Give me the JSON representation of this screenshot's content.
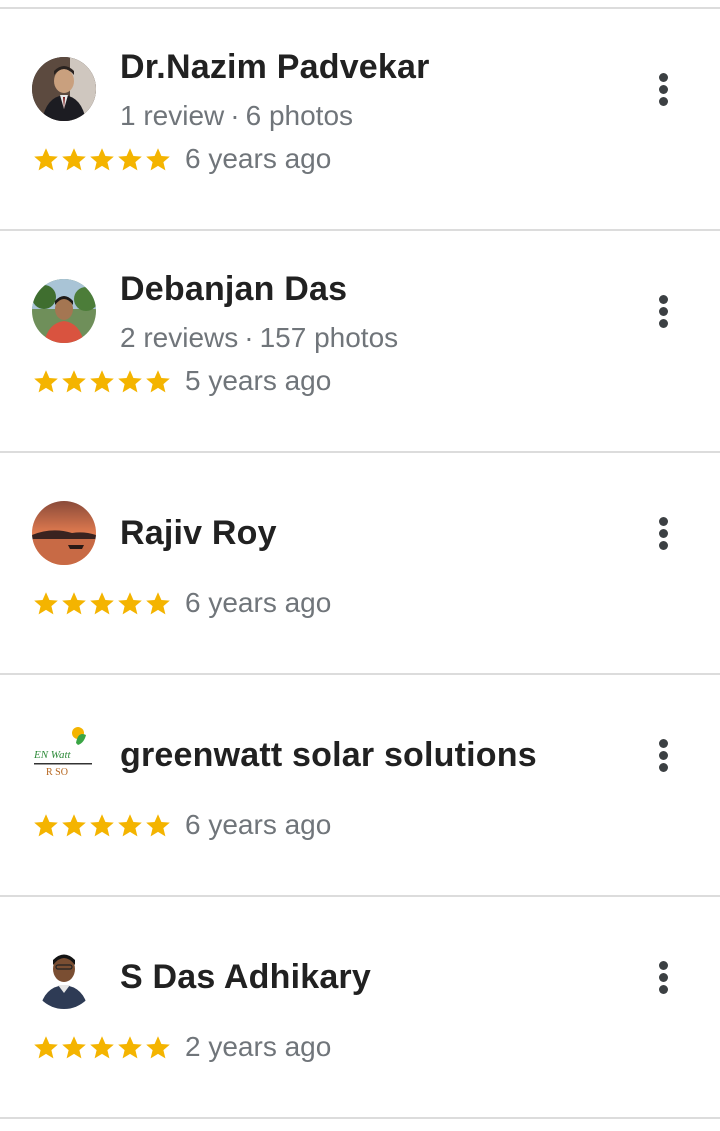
{
  "colors": {
    "star": "#F4B400",
    "divider": "#DCDCDC",
    "name_text": "#212121",
    "secondary_text": "#70757A",
    "menu_icon": "#3C4043"
  },
  "reviews": [
    {
      "name": "Dr.Nazim Padvekar",
      "meta_reviews": "1 review",
      "meta_separator": "·",
      "meta_photos": "6 photos",
      "rating": 5,
      "time": "6 years ago",
      "avatar": "profile-photo"
    },
    {
      "name": "Debanjan Das",
      "meta_reviews": "2 reviews",
      "meta_separator": "·",
      "meta_photos": "157 photos",
      "rating": 5,
      "time": "5 years ago",
      "avatar": "profile-photo"
    },
    {
      "name": "Rajiv Roy",
      "rating": 5,
      "time": "6 years ago",
      "avatar": "sunset-photo"
    },
    {
      "name": "greenwatt solar solutions",
      "rating": 5,
      "time": "6 years ago",
      "avatar": "logo",
      "avatar_logo_text": "EN Watt",
      "avatar_logo_subtext": "R SO"
    },
    {
      "name": "S Das Adhikary",
      "rating": 5,
      "time": "2 years ago",
      "avatar": "profile-photo"
    }
  ],
  "icons": {
    "rating_star": "star-icon",
    "overflow_menu": "more-vert-icon"
  }
}
